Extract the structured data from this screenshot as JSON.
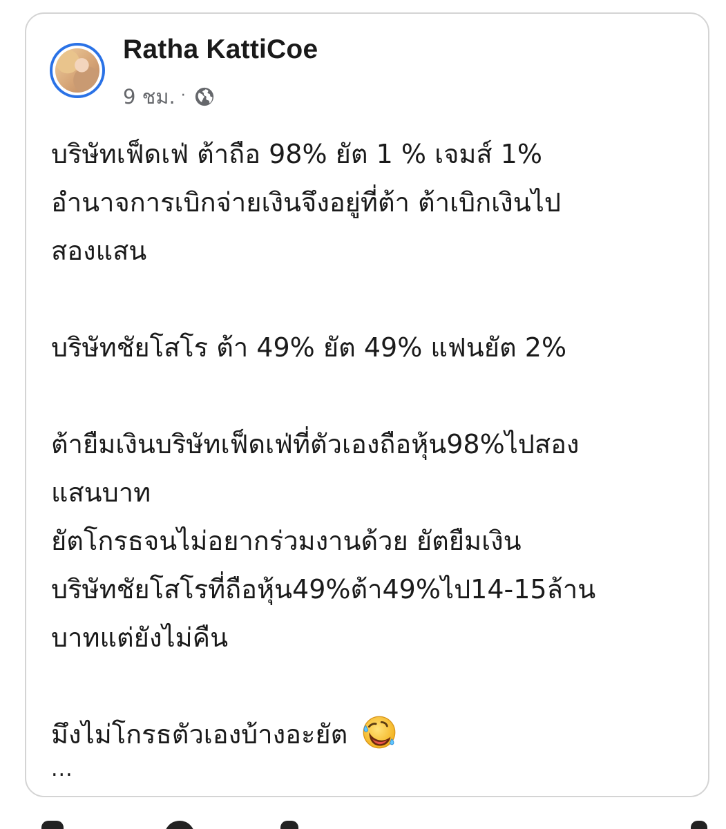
{
  "post": {
    "author": "Ratha KattiCoe",
    "timestamp": "9 ชม.",
    "separator": "·",
    "privacy_icon": "globe-icon",
    "lines": [
      "บริษัทเฟ็ดเฟ่ ต้าถือ 98% ยัต 1 % เจมส์ 1%",
      "อำนาจการเบิกจ่ายเงินจึงอยู่ที่ต้า ต้าเบิกเงินไป",
      "สองแสน",
      "",
      "บริษัทชัยโสโร ต้า 49% ยัต 49% แฟนยัต 2%",
      "",
      "ต้ายืมเงินบริษัทเฟ็ดเฟ่ที่ตัวเองถือหุ้น98%ไปสอง",
      "แสนบาท",
      "ยัตโกรธจนไม่อยากร่วมงานด้วย ยัตยืมเงิน",
      "บริษัทชัยโสโรที่ถือหุ้น49%ต้า49%ไป14-15ล้าน",
      "บาทแต่ยังไม่คืน",
      "",
      "มึงไม่โกรธตัวเองบ้างอะยัต"
    ],
    "last_line_emoji": "rolling-on-floor-laughing-emoji",
    "see_more": "..."
  },
  "colors": {
    "avatar_ring": "#2a72e6",
    "meta_text": "#65676b",
    "card_border": "#d4d4d4",
    "text": "#1a1a1a"
  }
}
